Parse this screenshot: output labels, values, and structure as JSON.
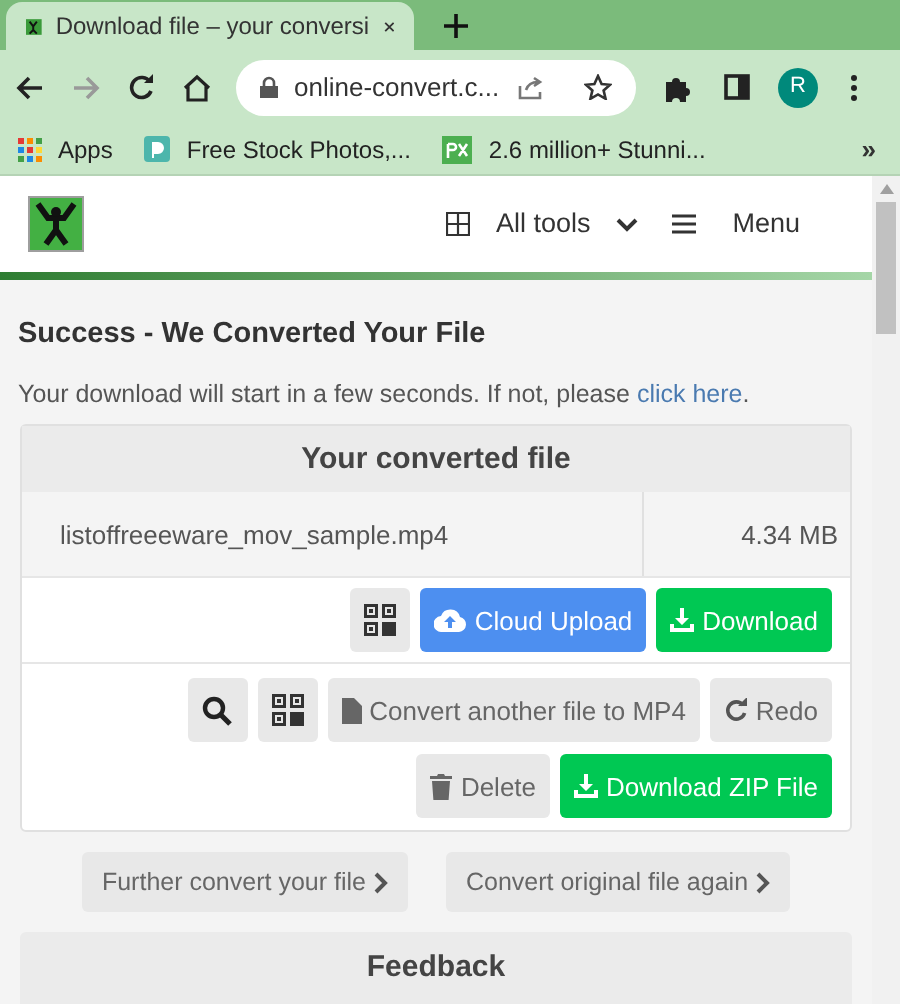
{
  "browser": {
    "tab_title": "Download file – your conversi",
    "url": "online-convert.c...",
    "profile_initial": "R",
    "bookmarks": [
      {
        "kind": "apps",
        "label": "Apps"
      },
      {
        "kind": "d",
        "label": "Free Stock Photos,..."
      },
      {
        "kind": "px",
        "label": "2.6 million+ Stunni..."
      }
    ],
    "bookmarks_overflow": "»"
  },
  "header": {
    "all_tools": "All tools",
    "menu": "Menu"
  },
  "success": {
    "title": "Success - We Converted Your File",
    "message": "Your download will start in a few seconds. If not, please ",
    "link": "click here",
    "after_link": "."
  },
  "card": {
    "title": "Your converted file",
    "file_name": "listoffreeeware_mov_sample.mp4",
    "file_size": "4.34 MB",
    "button_rows": [
      [
        {
          "kind": "qr"
        },
        {
          "kind": "cloud",
          "label": "Cloud Upload"
        },
        {
          "kind": "download",
          "label": "Download"
        }
      ],
      [
        {
          "kind": "search"
        },
        {
          "kind": "qr"
        },
        {
          "kind": "convert",
          "label": "Convert another file to MP4"
        },
        {
          "kind": "redo",
          "label": "Redo"
        }
      ],
      [
        {
          "kind": "delete",
          "label": "Delete"
        },
        {
          "kind": "download",
          "label": "Download ZIP File"
        }
      ]
    ]
  },
  "links": [
    "Further convert your file",
    "Convert original file again"
  ],
  "feedback": {
    "title": "Feedback"
  }
}
